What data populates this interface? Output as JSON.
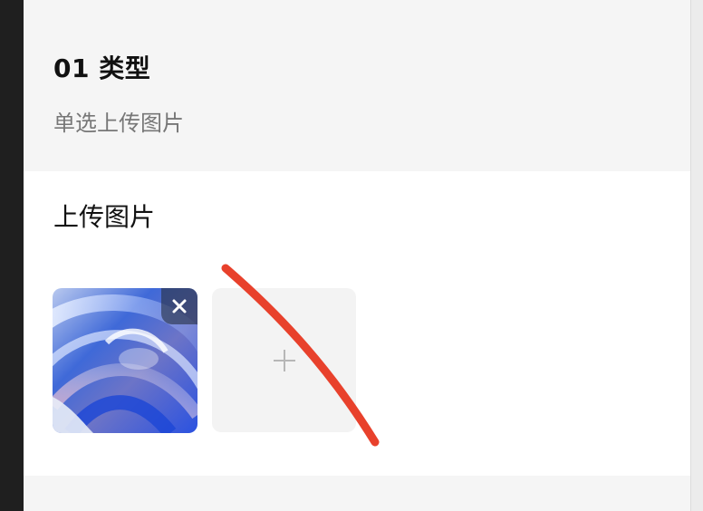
{
  "section": {
    "title": "01 类型",
    "subtitle": "单选上传图片"
  },
  "uploader": {
    "label": "上传图片",
    "images": [
      {
        "icon": "abstract-swirl-image",
        "remove_icon": "close-icon"
      }
    ],
    "add_icon": "plus-icon"
  },
  "colors": {
    "annotation_stroke": "#e8412c",
    "background": "#f5f5f5",
    "card": "#ffffff",
    "add_tile": "#f3f3f3"
  }
}
